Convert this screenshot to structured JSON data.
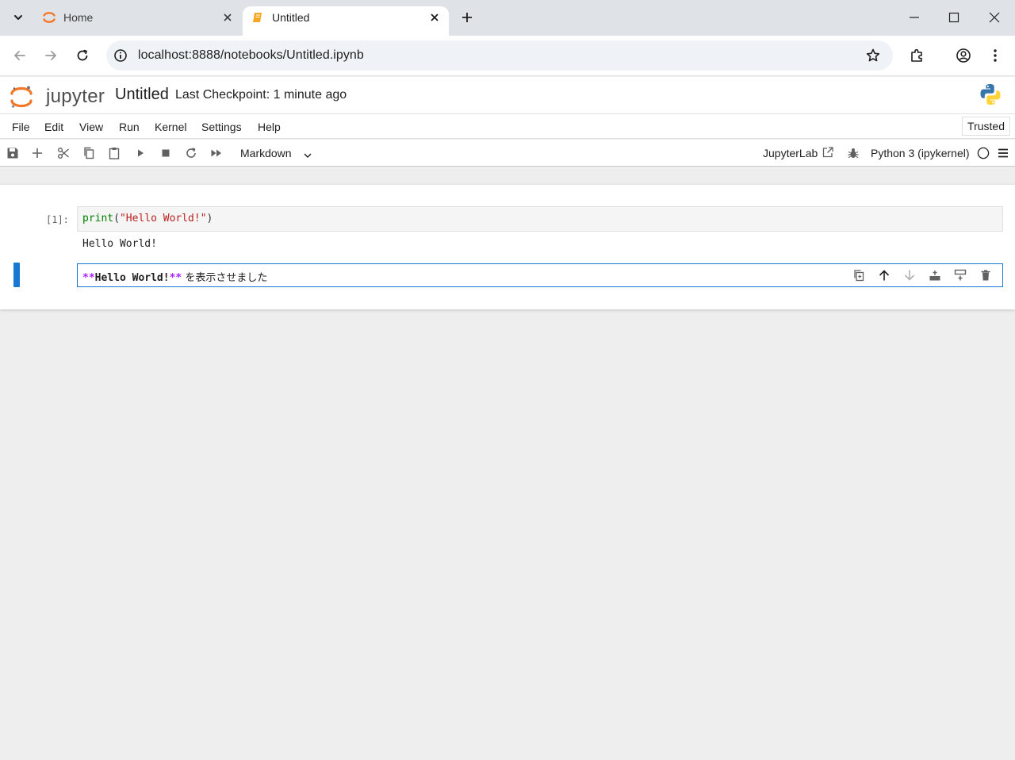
{
  "browser": {
    "tabs": [
      {
        "title": "Home",
        "favicon": "jupyter-spinner-icon",
        "active": false
      },
      {
        "title": "Untitled",
        "favicon": "notebook-icon",
        "active": true
      }
    ],
    "url": "localhost:8888/notebooks/Untitled.ipynb"
  },
  "jupyter": {
    "logo_text": "jupyter",
    "notebook_title": "Untitled",
    "checkpoint": "Last Checkpoint: 1 minute ago"
  },
  "menu": {
    "items": [
      "File",
      "Edit",
      "View",
      "Run",
      "Kernel",
      "Settings",
      "Help"
    ],
    "trusted": "Trusted"
  },
  "toolbar": {
    "cell_type": "Markdown",
    "jupyterlab_link": "JupyterLab",
    "kernel": "Python 3 (ipykernel)"
  },
  "cells": {
    "code": {
      "prompt": "[1]:",
      "builtin": "print",
      "open_paren": "(",
      "string": "\"Hello World!\"",
      "close_paren": ")",
      "output": "Hello World!"
    },
    "markdown": {
      "mark_open": "**",
      "bold_text": "Hello World!",
      "mark_close": "**",
      "rest": " を表示させました"
    }
  },
  "colors": {
    "accent": "#1976d2",
    "jupyter_orange": "#f37726",
    "md_markup": "#aa22ff",
    "string": "#ba2121",
    "builtin": "#008000"
  }
}
